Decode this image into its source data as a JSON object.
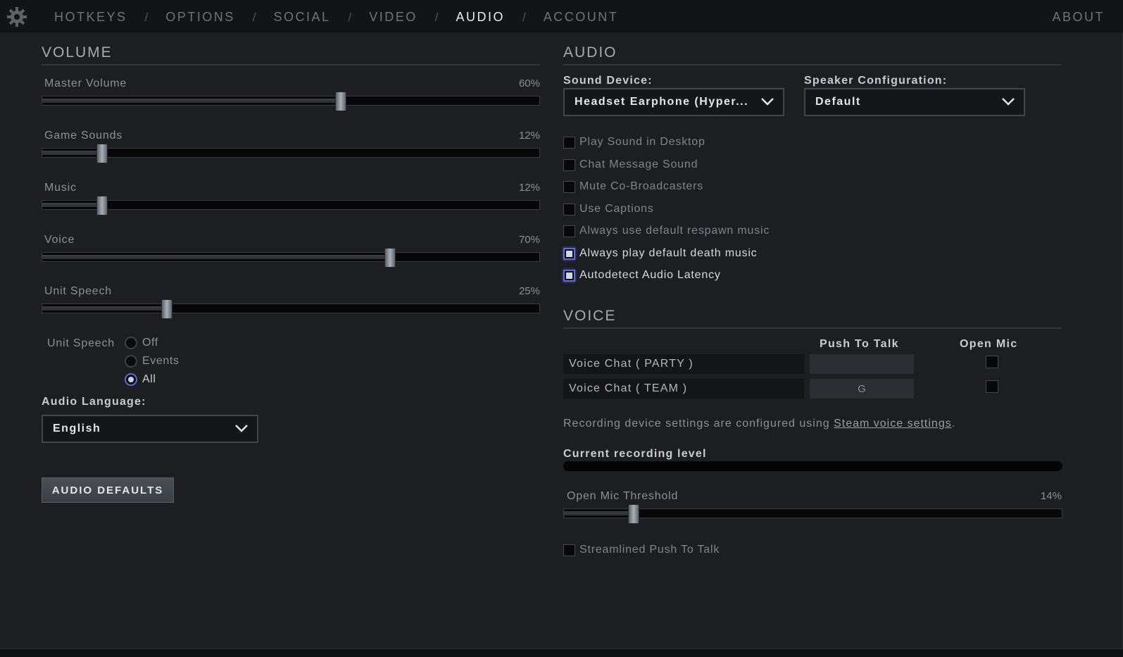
{
  "nav": {
    "tabs": [
      {
        "label": "HOTKEYS"
      },
      {
        "label": "OPTIONS"
      },
      {
        "label": "SOCIAL"
      },
      {
        "label": "VIDEO"
      },
      {
        "label": "AUDIO",
        "active": true
      },
      {
        "label": "ACCOUNT"
      }
    ],
    "separator": "/",
    "about": "ABOUT",
    "settings_icon": "gear-icon"
  },
  "volume": {
    "title": "VOLUME",
    "sliders": [
      {
        "label": "Master Volume",
        "value_text": "60%",
        "value": 60
      },
      {
        "label": "Game Sounds",
        "value_text": "12%",
        "value": 12
      },
      {
        "label": "Music",
        "value_text": "12%",
        "value": 12
      },
      {
        "label": "Voice",
        "value_text": "70%",
        "value": 70
      },
      {
        "label": "Unit Speech",
        "value_text": "25%",
        "value": 25
      }
    ],
    "unit_speech_radio": {
      "label": "Unit Speech",
      "options": [
        "Off",
        "Events",
        "All"
      ],
      "selected": "All"
    },
    "audio_language_label": "Audio Language:",
    "audio_language_value": "English",
    "defaults_button": "AUDIO DEFAULTS"
  },
  "audio": {
    "title": "AUDIO",
    "sound_device_label": "Sound Device:",
    "sound_device_value": "Headset Earphone (Hyper...",
    "speaker_config_label": "Speaker Configuration:",
    "speaker_config_value": "Default",
    "checkboxes": [
      {
        "label": "Play Sound in Desktop",
        "checked": false
      },
      {
        "label": "Chat Message Sound",
        "checked": false
      },
      {
        "label": "Mute Co-Broadcasters",
        "checked": false
      },
      {
        "label": "Use Captions",
        "checked": false
      },
      {
        "label": "Always use default respawn music",
        "checked": false
      },
      {
        "label": "Always play default death music",
        "checked": true
      },
      {
        "label": "Autodetect Audio Latency",
        "checked": true
      }
    ]
  },
  "voice": {
    "title": "VOICE",
    "col_push_to_talk": "Push To Talk",
    "col_open_mic": "Open Mic",
    "rows": [
      {
        "label": "Voice Chat ( PARTY )",
        "key": "",
        "open_mic": false
      },
      {
        "label": "Voice Chat ( TEAM )",
        "key": "G",
        "open_mic": false
      }
    ],
    "info_prefix": "Recording device settings are configured using ",
    "info_link": "Steam voice settings",
    "info_suffix": ".",
    "recording_level_label": "Current recording level",
    "recording_level": 0,
    "threshold_label": "Open Mic Threshold",
    "threshold_value_text": "14%",
    "threshold_value": 14,
    "streamlined_label": "Streamlined Push To Talk",
    "streamlined_checked": false
  }
}
